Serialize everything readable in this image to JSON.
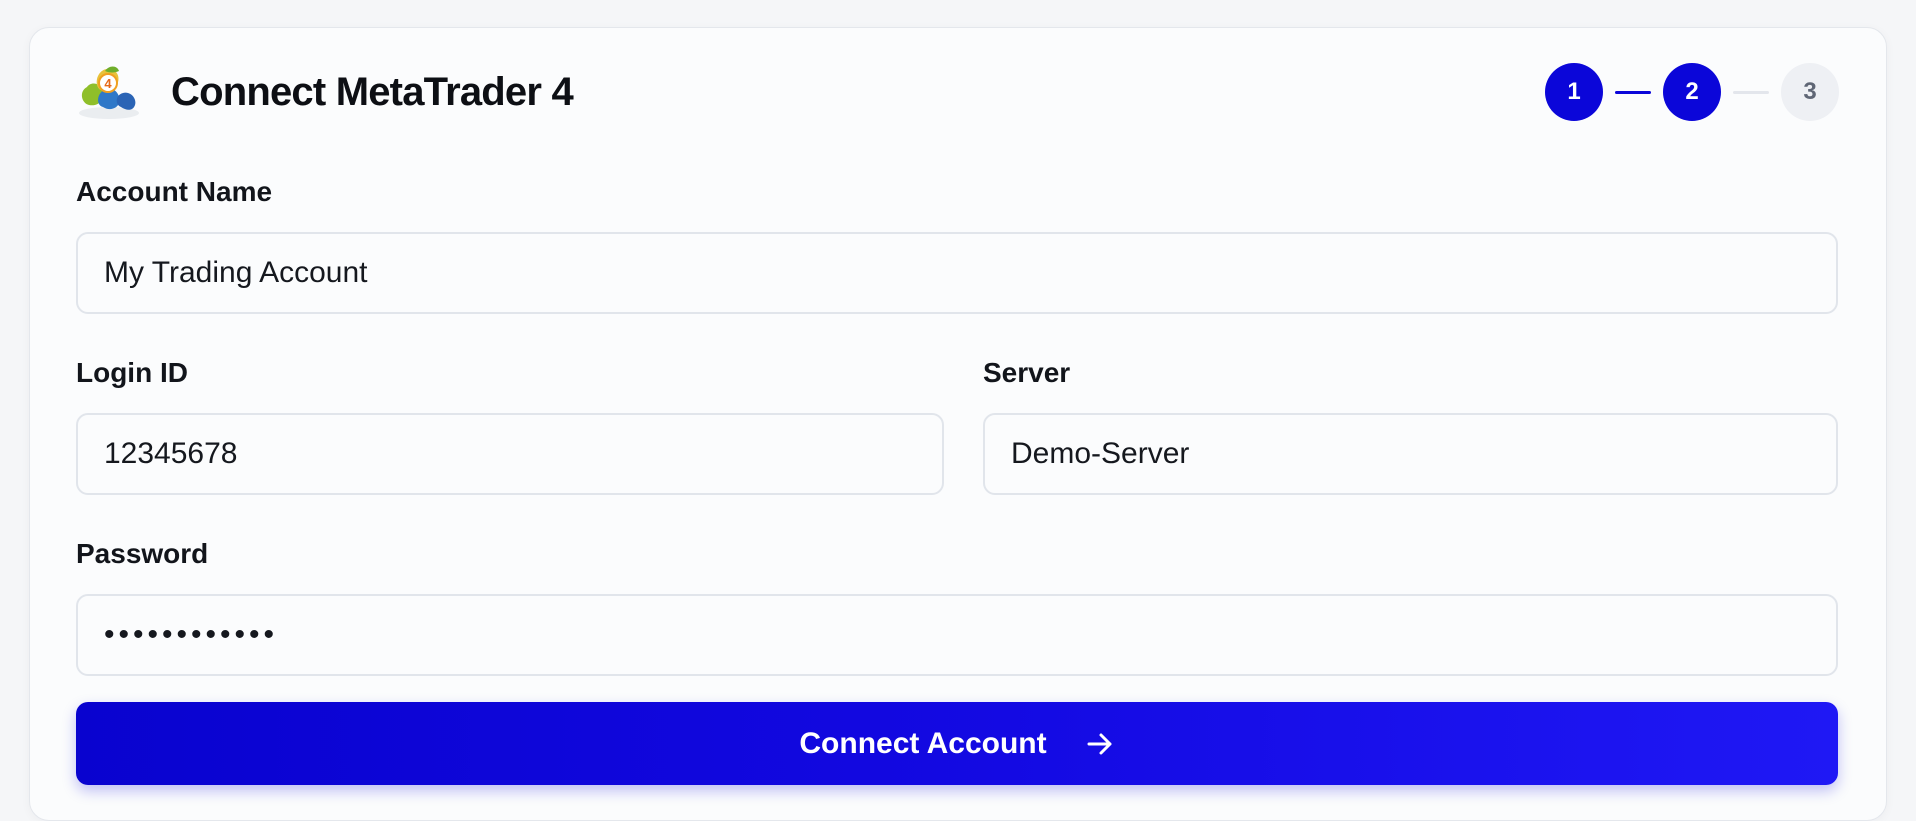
{
  "header": {
    "title": "Connect MetaTrader 4",
    "logo_icon": "metatrader-4-logo-icon",
    "logo_badge": "4"
  },
  "stepper": {
    "steps": [
      {
        "label": "1",
        "state": "active"
      },
      {
        "label": "2",
        "state": "active"
      },
      {
        "label": "3",
        "state": "todo"
      }
    ]
  },
  "form": {
    "account_name": {
      "label": "Account Name",
      "value": "My Trading Account"
    },
    "login_id": {
      "label": "Login ID",
      "value": "12345678"
    },
    "server": {
      "label": "Server",
      "value": "Demo-Server"
    },
    "password": {
      "label": "Password",
      "value": "••••••••••••"
    }
  },
  "actions": {
    "connect_label": "Connect Account",
    "connect_icon": "arrow-right-icon"
  },
  "colors": {
    "accent": "#0b06d9",
    "step_todo_bg": "#eef0f4",
    "card_bg": "#fbfcfd"
  }
}
